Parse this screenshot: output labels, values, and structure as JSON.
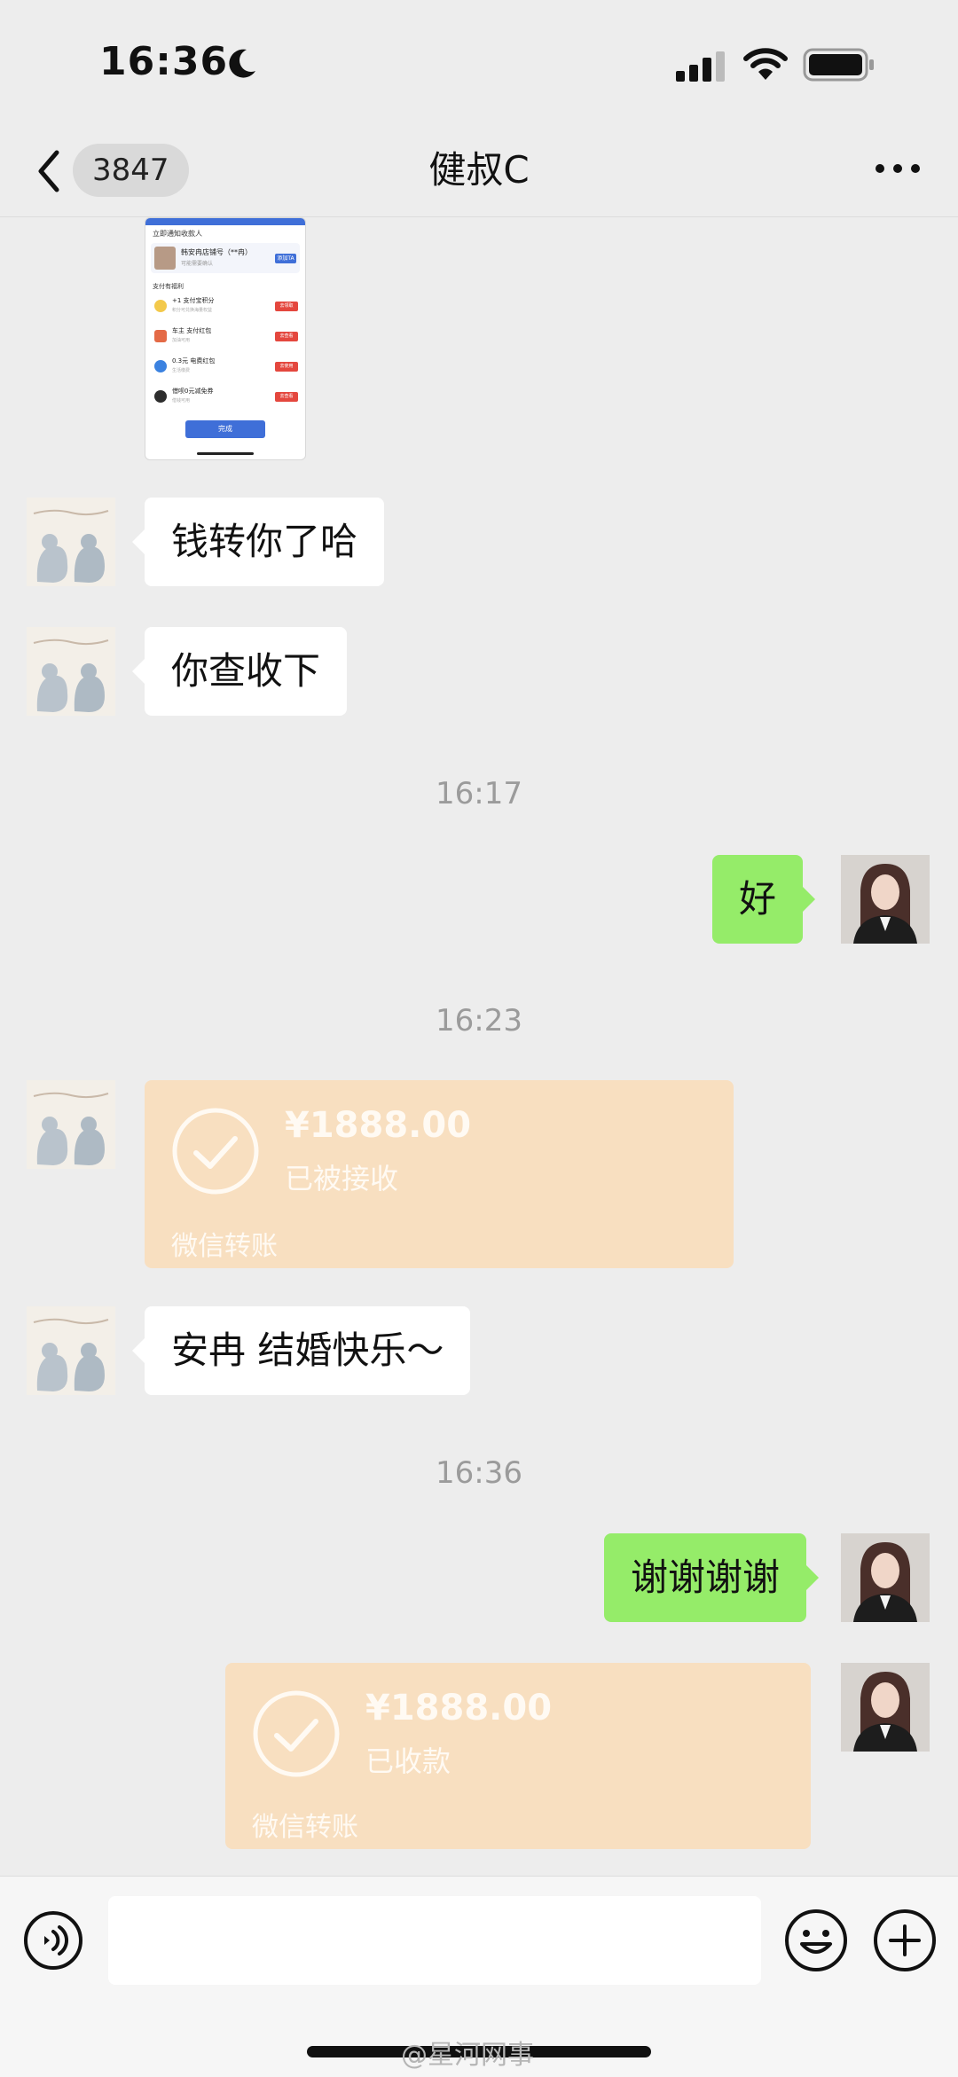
{
  "status_bar": {
    "time": "16:36"
  },
  "nav": {
    "unread_count": "3847",
    "title": "健叔C"
  },
  "shared_screenshot": {
    "header": "立即通知收款人",
    "payee_name": "韩安冉店铺号（**冉）",
    "payee_sub": "可能需要确认",
    "payee_button": "添加TA",
    "section_title": "支付有福利",
    "rows": [
      {
        "title": "+1 支付宝积分",
        "sub": "积分可兑换海量权益",
        "button": "去领取"
      },
      {
        "title": "车主 支付红包",
        "sub": "加油可用",
        "button": "去查看"
      },
      {
        "title": "0.3元 电费红包",
        "sub": "生活缴费",
        "button": "去使用"
      },
      {
        "title": "借呗0元减免券",
        "sub": "借钱可用",
        "button": "去查看"
      }
    ],
    "done_button": "完成"
  },
  "messages": {
    "m1": "钱转你了哈",
    "m2": "你查收下",
    "t1": "16:17",
    "m3": "好",
    "t2": "16:23",
    "transfer1": {
      "amount": "¥1888.00",
      "state": "已被接收",
      "label": "微信转账"
    },
    "m4": "安冉 结婚快乐～",
    "t3": "16:36",
    "m5": "谢谢谢谢",
    "transfer2": {
      "amount": "¥1888.00",
      "state": "已收款",
      "label": "微信转账"
    }
  },
  "input": {
    "placeholder": ""
  },
  "watermark": "@星河网事",
  "colors": {
    "background": "#ededed",
    "green_bubble": "#95ec69",
    "transfer": "#f8dfc0"
  }
}
